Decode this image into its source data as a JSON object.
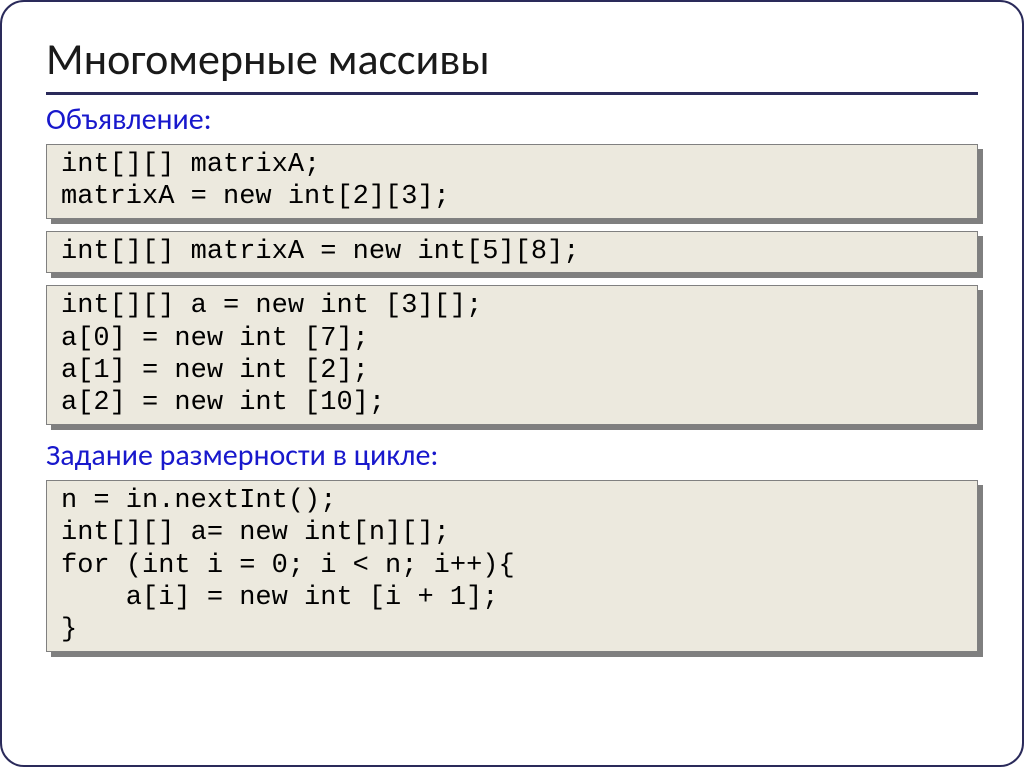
{
  "title": "Многомерные массивы",
  "sections": {
    "declaration": "Объявление:",
    "loop_dimension": "Задание размерности в цикле:"
  },
  "code_blocks": {
    "block1": "int[][] matrixA;\nmatrixA = new int[2][3];",
    "block2": "int[][] matrixA = new int[5][8];",
    "block3": "int[][] a = new int [3][];\na[0] = new int [7];\na[1] = new int [2];\na[2] = new int [10];",
    "block4": "n = in.nextInt();\nint[][] a= new int[n][];\nfor (int i = 0; i < n; i++){\n    a[i] = new int [i + 1];\n}"
  }
}
